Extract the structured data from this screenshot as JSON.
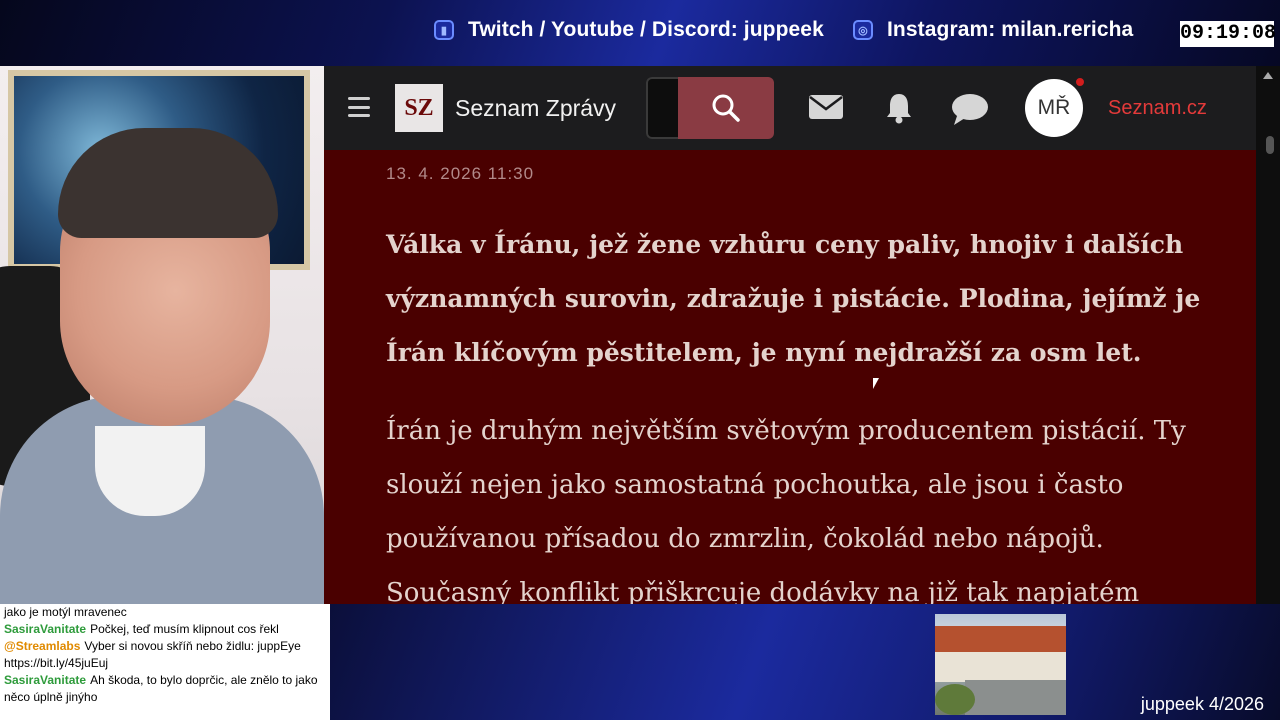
{
  "stream": {
    "social_primary": "Twitch / Youtube / Discord: juppeek",
    "social_instagram": "Instagram: milan.rericha",
    "clock": "09:19:08",
    "footer_tag": "juppeek 4/2026"
  },
  "browser": {
    "site_logo": "SZ",
    "site_name": "Seznam Zprávy",
    "avatar_initials": "MŘ",
    "seznam_link": "Seznam.cz",
    "search_placeholder": "",
    "colors": {
      "page_bg": "#4a0000",
      "navbar_bg": "#1c1c1e",
      "search_button": "#8a3b43",
      "link": "#e43a3a"
    }
  },
  "article": {
    "date": "13. 4. 2026 11:30",
    "lead": "Válka v Íránu, jež žene vzhůru ceny paliv, hnojiv i dalších významných surovin, zdražuje i pistácie. Plodina, jejímž je Írán klíčovým pěstitelem, je nyní nejdražší za osm let.",
    "body": "Írán je druhým největším světovým producentem pistácií. Ty slouží nejen jako samostatná pochoutka, ale jsou i často používanou přísadou do zmrzlin, čokolád nebo nápojů. Současný konflikt přiškrcuje dodávky na již tak napjatém"
  },
  "chat": [
    {
      "user": "",
      "message": "jako je motýl mravenec"
    },
    {
      "user": "SasiraVanitate",
      "message": "Počkej, teď musím klipnout cos řekl"
    },
    {
      "user": "@Streamlabs",
      "message": "Vyber si novou skříň nebo židlu: juppEye https://bit.ly/45juEuj"
    },
    {
      "user": "SasiraVanitate",
      "message": "Ah škoda, to bylo doprčic, ale znělo to jako něco úplně jinýho"
    }
  ]
}
